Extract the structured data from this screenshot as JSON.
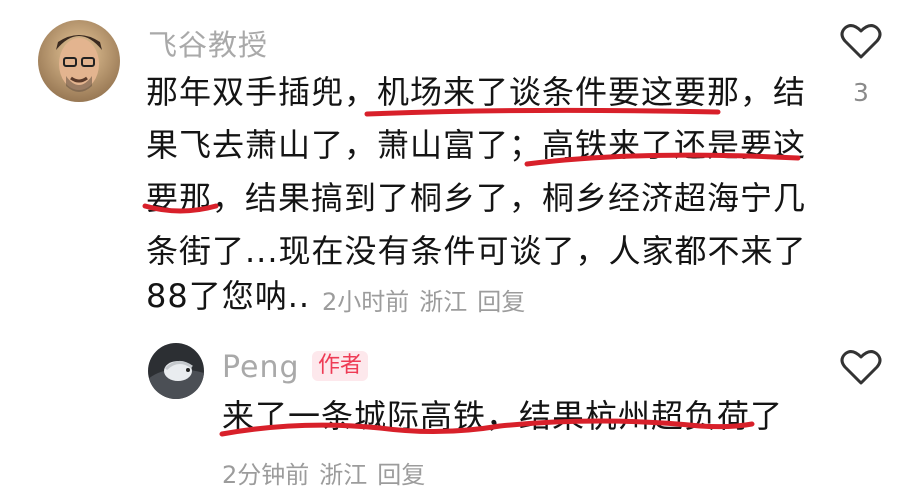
{
  "comment": {
    "username": "飞谷教授",
    "lines": [
      "那年双手插兜，机场来了谈条件要这要那，结",
      "果飞去萧山了，萧山富了；高铁来了还是要这",
      "要那，结果搞到了桐乡了，桐乡经济超海宁几",
      "条街了...现在没有条件可谈了，人家都不来了",
      "88了您呐..."
    ],
    "time": "2小时前",
    "location": "浙江",
    "reply_label": "回复",
    "like_count": "3",
    "like_icon": "heart-outline-icon"
  },
  "reply": {
    "username": "Peng",
    "badge": "作者",
    "text": "来了一条城际高铁，结果杭州超负荷了",
    "time": "2分钟前",
    "location": "浙江",
    "reply_label": "回复",
    "like_icon": "heart-outline-icon"
  },
  "colors": {
    "underline": "#d8202a",
    "badge_text": "#ee3b55",
    "badge_bg": "#fde8ec",
    "meta": "#9c9c9c"
  }
}
